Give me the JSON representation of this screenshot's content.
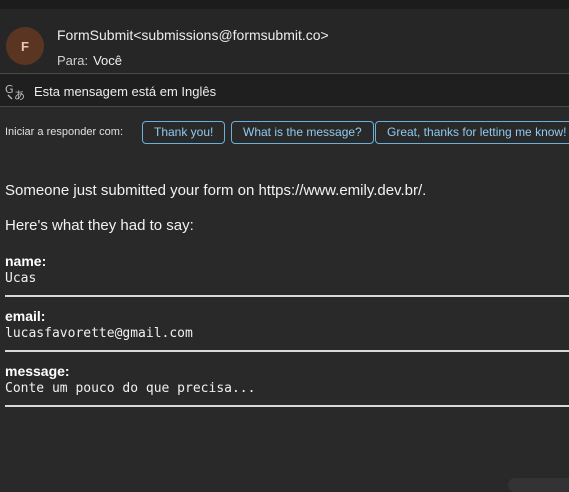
{
  "header": {
    "avatar_letter": "F",
    "sender": "FormSubmit<submissions@formsubmit.co>",
    "to_label": "Para:",
    "to_value": "Você"
  },
  "translation": {
    "icon": "translate-icon",
    "text": "Esta mensagem está em Inglês"
  },
  "quick_reply": {
    "label": "Iniciar a responder com:",
    "options": [
      "Thank you!",
      "What is the message?",
      "Great, thanks for letting me know!"
    ]
  },
  "message": {
    "intro": "Someone just submitted your form on https://www.emily.dev.br/.",
    "lead": "Here's what they had to say:",
    "fields": [
      {
        "label": "name:",
        "value": "Ucas"
      },
      {
        "label": "email:",
        "value": "lucasfavorette@gmail.com"
      },
      {
        "label": "message:",
        "value": "Conte um pouco do que precisa..."
      }
    ]
  },
  "colors": {
    "background": "#292929",
    "chip_border": "#6ab0db",
    "avatar": "#5a3622"
  }
}
